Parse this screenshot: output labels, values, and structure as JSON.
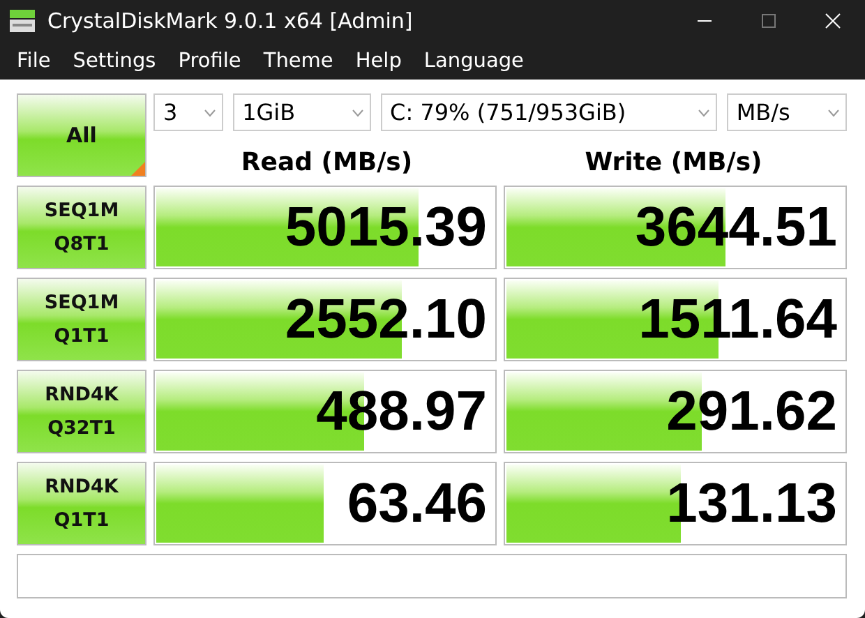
{
  "window": {
    "title": "CrystalDiskMark 9.0.1 x64 [Admin]"
  },
  "menu": [
    "File",
    "Settings",
    "Profile",
    "Theme",
    "Help",
    "Language"
  ],
  "all_button": {
    "label": "All"
  },
  "selectors": [
    {
      "value": "3"
    },
    {
      "value": "1GiB"
    },
    {
      "value": "C: 79% (751/953GiB)"
    },
    {
      "value": "MB/s"
    }
  ],
  "columns": [
    "Read (MB/s)",
    "Write (MB/s)"
  ],
  "tests": [
    {
      "label": [
        "SEQ1M",
        "Q8T1"
      ],
      "read": {
        "value": "5015.39",
        "level": 0.78
      },
      "write": {
        "value": "3644.51",
        "level": 0.65
      }
    },
    {
      "label": [
        "SEQ1M",
        "Q1T1"
      ],
      "read": {
        "value": "2552.10",
        "level": 0.73
      },
      "write": {
        "value": "1511.64",
        "level": 0.63
      }
    },
    {
      "label": [
        "RND4K",
        "Q32T1"
      ],
      "read": {
        "value": "488.97",
        "level": 0.62
      },
      "write": {
        "value": "291.62",
        "level": 0.58
      }
    },
    {
      "label": [
        "RND4K",
        "Q1T1"
      ],
      "read": {
        "value": "63.46",
        "level": 0.5
      },
      "write": {
        "value": "131.13",
        "level": 0.52
      }
    }
  ]
}
